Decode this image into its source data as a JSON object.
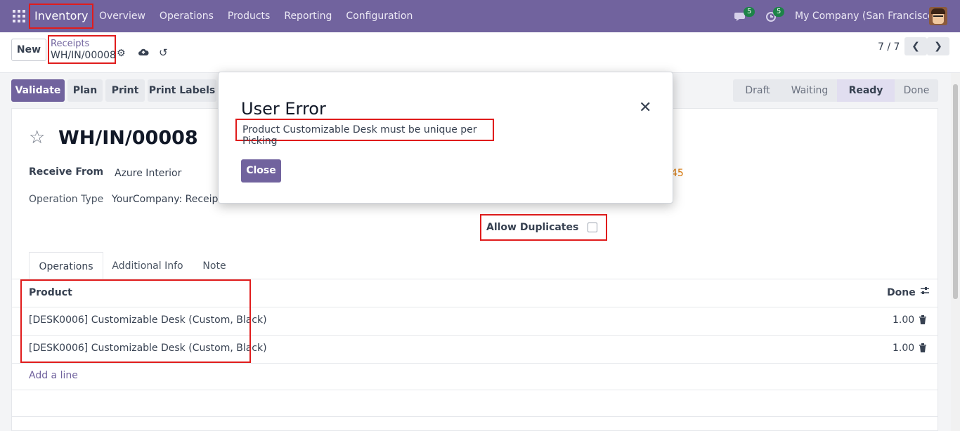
{
  "navbar": {
    "app_name": "Inventory",
    "menu": [
      "Overview",
      "Operations",
      "Products",
      "Reporting",
      "Configuration"
    ],
    "messages_badge": "5",
    "activities_badge": "5",
    "company": "My Company (San Francisco)"
  },
  "control_panel": {
    "new_label": "New",
    "breadcrumb_parent": "Receipts",
    "breadcrumb_current": "WH/IN/00008",
    "pager": "7 / 7"
  },
  "statusbar": {
    "buttons": [
      "Validate",
      "Plan",
      "Print",
      "Print Labels"
    ],
    "stages": [
      "Draft",
      "Waiting",
      "Ready",
      "Done"
    ],
    "active_stage": "Ready"
  },
  "form": {
    "record_name": "WH/IN/00008",
    "receive_from_label": "Receive From",
    "receive_from_value": "Azure Interior",
    "operation_type_label": "Operation Type",
    "operation_type_value": "YourCompany: Receipts",
    "partial_right_value": "45",
    "allow_duplicates_label": "Allow Duplicates",
    "allow_duplicates_checked": false
  },
  "tabs": [
    "Operations",
    "Additional Info",
    "Note"
  ],
  "lines": {
    "columns": [
      "Product",
      "Done"
    ],
    "rows": [
      {
        "product": "[DESK0006] Customizable Desk (Custom, Black)",
        "done": "1.00"
      },
      {
        "product": "[DESK0006] Customizable Desk (Custom, Black)",
        "done": "1.00"
      }
    ],
    "add_line": "Add a line"
  },
  "dialog": {
    "title": "User Error",
    "message": "Product Customizable Desk must be unique per Picking",
    "close_label": "Close"
  },
  "colors": {
    "brand": "#71639e",
    "highlight": "#e01c1c",
    "badge": "#1d8348",
    "link_warning": "#d97706"
  }
}
